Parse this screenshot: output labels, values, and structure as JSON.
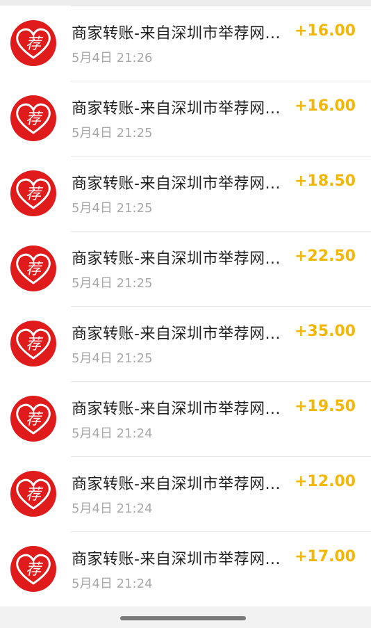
{
  "transactions": [
    {
      "title": "商家转账-来自深圳市举荐网...",
      "time": "5月4日 21:26",
      "amount": "+16.00"
    },
    {
      "title": "商家转账-来自深圳市举荐网...",
      "time": "5月4日 21:25",
      "amount": "+16.00"
    },
    {
      "title": "商家转账-来自深圳市举荐网...",
      "time": "5月4日 21:25",
      "amount": "+18.50"
    },
    {
      "title": "商家转账-来自深圳市举荐网...",
      "time": "5月4日 21:25",
      "amount": "+22.50"
    },
    {
      "title": "商家转账-来自深圳市举荐网...",
      "time": "5月4日 21:25",
      "amount": "+35.00"
    },
    {
      "title": "商家转账-来自深圳市举荐网...",
      "time": "5月4日 21:24",
      "amount": "+19.50"
    },
    {
      "title": "商家转账-来自深圳市举荐网...",
      "time": "5月4日 21:24",
      "amount": "+12.00"
    },
    {
      "title": "商家转账-来自深圳市举荐网...",
      "time": "5月4日 21:24",
      "amount": "+17.00"
    }
  ],
  "avatar_glyph": "荐",
  "colors": {
    "avatar_bg": "#e01b1b",
    "amount": "#f2b705",
    "title": "#1f1f1f",
    "time": "#a8a8a8"
  }
}
